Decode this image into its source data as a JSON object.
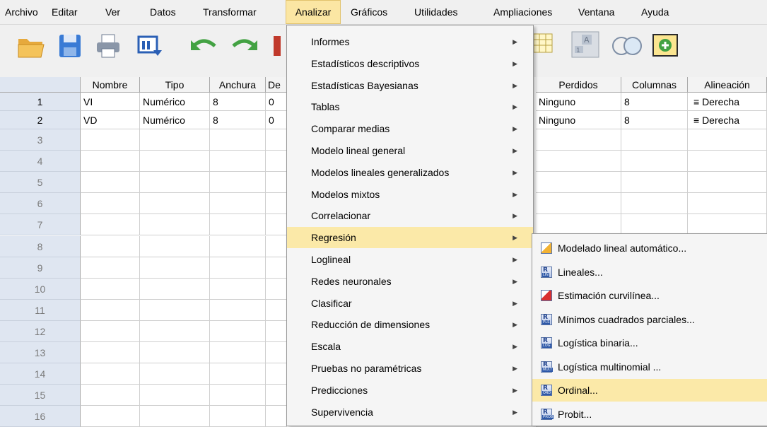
{
  "menubar": {
    "items": [
      "Archivo",
      "Editar",
      "Ver",
      "Datos",
      "Transformar",
      "Analizar",
      "Gráficos",
      "Utilidades",
      "Ampliaciones",
      "Ventana",
      "Ayuda"
    ],
    "active": "Analizar"
  },
  "toolbar": {
    "icons": [
      "open-folder-icon",
      "save-icon",
      "print-icon",
      "dialog-recall-icon",
      "undo-icon",
      "redo-icon",
      "goto-case-icon",
      "weight-cases-icon",
      "split-file-icon",
      "value-labels-icon",
      "use-sets-icon",
      "add-extension-icon"
    ]
  },
  "grid": {
    "columns": [
      "Nombre",
      "Tipo",
      "Anchura",
      "De"
    ],
    "right_columns": [
      "Perdidos",
      "Columnas",
      "Alineación"
    ],
    "rows": [
      {
        "num": "1",
        "nombre": "VI",
        "tipo": "Numérico",
        "anchura": "8",
        "dec": "0",
        "perdidos": "Ninguno",
        "columnas": "8",
        "alineacion": "Derecha"
      },
      {
        "num": "2",
        "nombre": "VD",
        "tipo": "Numérico",
        "anchura": "8",
        "dec": "0",
        "perdidos": "Ninguno",
        "columnas": "8",
        "alineacion": "Derecha"
      }
    ],
    "empty_rows": [
      "3",
      "4",
      "5",
      "6",
      "7",
      "8",
      "9",
      "10",
      "11",
      "12",
      "13",
      "14",
      "15",
      "16"
    ]
  },
  "analizar_menu": {
    "items": [
      "Informes",
      "Estadísticos descriptivos",
      "Estadísticas Bayesianas",
      "Tablas",
      "Comparar medias",
      "Modelo lineal general",
      "Modelos lineales generalizados",
      "Modelos mixtos",
      "Correlacionar",
      "Regresión",
      "Loglineal",
      "Redes neuronales",
      "Clasificar",
      "Reducción de dimensiones",
      "Escala",
      "Pruebas no paramétricas",
      "Predicciones",
      "Supervivencia"
    ],
    "highlighted": "Regresión"
  },
  "regresion_submenu": {
    "items": [
      {
        "label": "Modelado lineal automático...",
        "icon": "auto-linear-icon",
        "badge": ""
      },
      {
        "label": "Lineales...",
        "icon": "linear-regression-icon",
        "badge": "LIN"
      },
      {
        "label": "Estimación curvilínea...",
        "icon": "curve-estimation-icon",
        "badge": ""
      },
      {
        "label": "Mínimos cuadrados parciales...",
        "icon": "pls-icon",
        "badge": "PLS"
      },
      {
        "label": "Logística binaria...",
        "icon": "binary-logistic-icon",
        "badge": "LOG"
      },
      {
        "label": "Logística multinomial ...",
        "icon": "multinomial-icon",
        "badge": "MULT"
      },
      {
        "label": "Ordinal...",
        "icon": "ordinal-icon",
        "badge": "ORD"
      },
      {
        "label": "Probit...",
        "icon": "probit-icon",
        "badge": "PROB"
      }
    ],
    "highlighted": "Ordinal..."
  },
  "colors": {
    "menu_highlight": "#fbe9a8",
    "row_header": "#dfe6f1"
  }
}
